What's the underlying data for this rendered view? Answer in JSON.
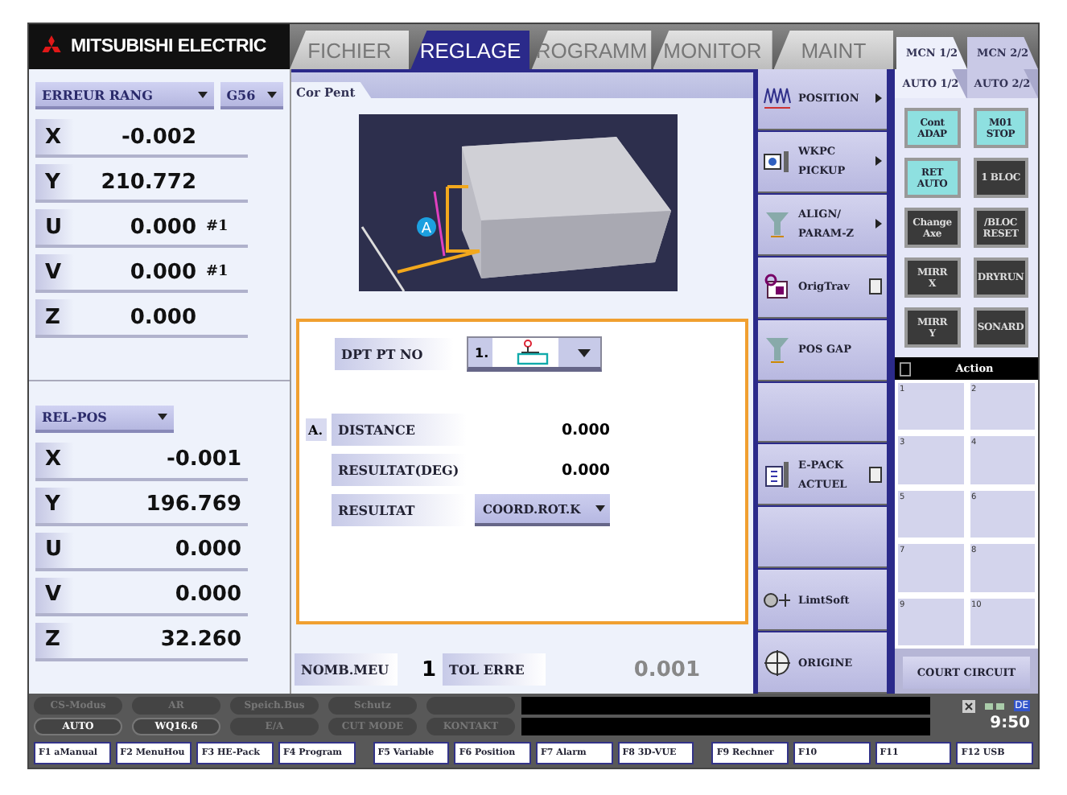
{
  "header": {
    "brand": "MITSUBISHI ELECTRIC",
    "tabs": [
      {
        "label": "FICHIER",
        "selected": false
      },
      {
        "label": "REGLAGE",
        "selected": true
      },
      {
        "label": "ROGRAMM",
        "selected": false
      },
      {
        "label": "MONITOR",
        "selected": false
      },
      {
        "label": "MAINT",
        "selected": false
      }
    ],
    "side_tabs": [
      {
        "label": "MCN 1/2",
        "selected": true
      },
      {
        "label": "MCN 2/2",
        "selected": false
      }
    ]
  },
  "position_top": {
    "mode": "ERREUR RANG",
    "coord": "G56",
    "axes": [
      {
        "axis": "X",
        "value": "-0.002"
      },
      {
        "axis": "Y",
        "value": "210.772"
      },
      {
        "axis": "U",
        "value": "0.000",
        "suffix": "#1"
      },
      {
        "axis": "V",
        "value": "0.000",
        "suffix": "#1"
      },
      {
        "axis": "Z",
        "value": "0.000"
      }
    ]
  },
  "position_bottom": {
    "mode": "REL-POS",
    "axes": [
      {
        "axis": "X",
        "value": "-0.001"
      },
      {
        "axis": "Y",
        "value": "196.769"
      },
      {
        "axis": "U",
        "value": "0.000"
      },
      {
        "axis": "V",
        "value": "0.000"
      },
      {
        "axis": "Z",
        "value": "32.260"
      }
    ]
  },
  "panel": {
    "title": "Cor Pent",
    "marker": "A",
    "point_label": "DPT PT NO",
    "point_value": "1.",
    "section": "A.",
    "rows": [
      {
        "kind": "value",
        "label": "DISTANCE",
        "value": "0.000"
      },
      {
        "kind": "value",
        "label": "RESULTAT(DEG)",
        "value": "0.000"
      },
      {
        "kind": "dropdown",
        "label": "RESULTAT",
        "value": "COORD.ROT.K"
      }
    ],
    "footer": [
      {
        "label": "NOMB.MEU",
        "value": "1",
        "disabled": false
      },
      {
        "label": "TOL ERRE",
        "value": "0.001",
        "disabled": true
      }
    ]
  },
  "softkeys": [
    {
      "kind": "key",
      "lines": [
        "POSITION"
      ],
      "arrow": true,
      "doc": false
    },
    {
      "kind": "key",
      "lines": [
        "WKPC",
        "PICKUP"
      ],
      "arrow": true,
      "doc": false
    },
    {
      "kind": "key",
      "lines": [
        "ALIGN/",
        "PARAM-Z"
      ],
      "arrow": true,
      "doc": false
    },
    {
      "kind": "key",
      "lines": [
        "OrigTrav"
      ],
      "arrow": false,
      "doc": true
    },
    {
      "kind": "key",
      "lines": [
        "POS GAP"
      ],
      "arrow": false,
      "doc": false
    },
    {
      "kind": "blank"
    },
    {
      "kind": "key",
      "lines": [
        "E-PACK",
        "ACTUEL"
      ],
      "arrow": false,
      "doc": true
    },
    {
      "kind": "blank"
    },
    {
      "kind": "key",
      "lines": [
        "LimtSoft"
      ],
      "arrow": false,
      "doc": false
    },
    {
      "kind": "key",
      "lines": [
        "ORIGINE"
      ],
      "arrow": false,
      "doc": false
    }
  ],
  "auto_tabs": [
    {
      "label": "AUTO 1/2",
      "selected": true
    },
    {
      "label": "AUTO 2/2",
      "selected": false
    }
  ],
  "toggles": [
    {
      "lines": [
        "Cont",
        "ADAP"
      ],
      "on": true
    },
    {
      "lines": [
        "M01",
        "STOP"
      ],
      "on": true
    },
    {
      "lines": [
        "RET",
        "AUTO"
      ],
      "on": true
    },
    {
      "lines": [
        "1 BLOC"
      ],
      "on": false
    },
    {
      "lines": [
        "Change",
        "Axe"
      ],
      "on": false
    },
    {
      "lines": [
        "/BLOC",
        "RESET"
      ],
      "on": false
    },
    {
      "lines": [
        "MIRR",
        "X"
      ],
      "on": false
    },
    {
      "lines": [
        "DRYRUN"
      ],
      "on": false
    },
    {
      "lines": [
        "MIRR",
        "Y"
      ],
      "on": false
    },
    {
      "lines": [
        "SONARD"
      ],
      "on": false
    }
  ],
  "action": {
    "title": "Action",
    "cells": [
      "1",
      "2",
      "3",
      "4",
      "5",
      "6",
      "7",
      "8",
      "9",
      "10"
    ]
  },
  "short_circuit": "COURT CIRCUIT",
  "status": {
    "row1": [
      {
        "label": "CS-Modus",
        "active": false
      },
      {
        "label": "AR",
        "active": false
      },
      {
        "label": "Speich.Bus",
        "active": false
      },
      {
        "label": "Schutz",
        "active": false
      }
    ],
    "row2": [
      {
        "label": "AUTO",
        "active": true
      },
      {
        "label": "WQ16.6",
        "active": true
      },
      {
        "label": "E/A",
        "active": false
      },
      {
        "label": "CUT MODE",
        "active": false
      },
      {
        "label": "KONTAKT",
        "active": false
      }
    ],
    "fkeys": [
      "F1 aManual",
      "F2 MenuHou",
      "F3 HE-Pack",
      "F4 Program",
      "F5 Variable",
      "F6 Position",
      "F7 Alarm",
      "F8 3D-VUE",
      "F9 Rechner",
      "F10",
      "F11",
      "F12 USB"
    ],
    "lang": "DE",
    "time": "9:50"
  }
}
